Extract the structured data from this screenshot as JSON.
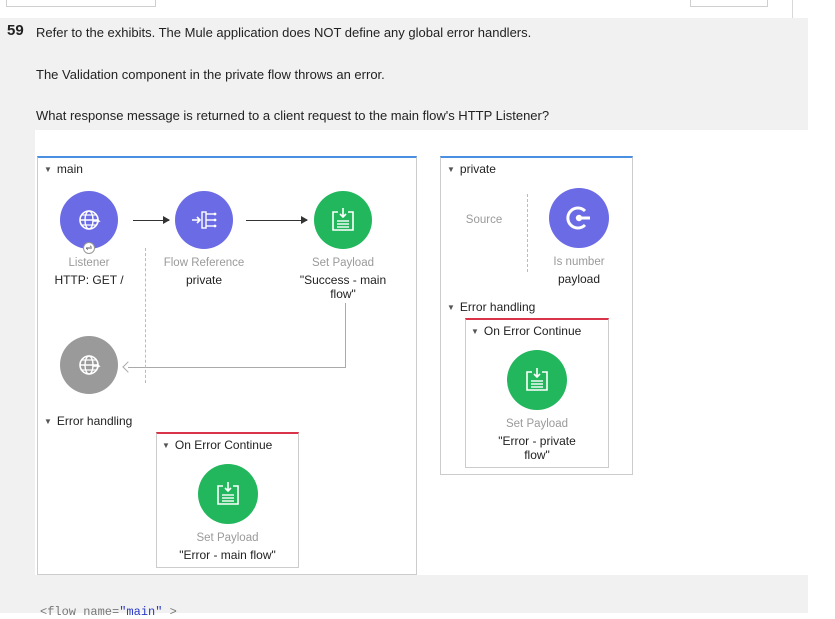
{
  "question": {
    "number": "59",
    "lines": [
      "Refer to the exhibits. The Mule application does NOT define any global error handlers.",
      "The Validation component in the private flow throws an error.",
      "What response message is returned to a client request to the main flow's HTTP Listener?"
    ]
  },
  "main_flow": {
    "title": "main",
    "listener": {
      "type": "Listener",
      "detail": "HTTP: GET /"
    },
    "flow_reference": {
      "type": "Flow Reference",
      "detail": "private"
    },
    "set_payload": {
      "type": "Set Payload",
      "detail": "\"Success - main flow\""
    },
    "error_handling_title": "Error handling",
    "on_error_continue": {
      "title": "On Error Continue",
      "set_payload": {
        "type": "Set Payload",
        "detail": "\"Error - main flow\""
      }
    }
  },
  "private_flow": {
    "title": "private",
    "source_label": "Source",
    "is_number": {
      "type": "Is number",
      "detail": "payload"
    },
    "error_handling_title": "Error handling",
    "on_error_continue": {
      "title": "On Error Continue",
      "set_payload": {
        "type": "Set Payload",
        "detail": "\"Error - private flow\""
      }
    }
  },
  "code_peek": {
    "prefix": "<flow name=",
    "value": "\"main\"",
    "suffix": " >"
  },
  "icons": [
    "globe-icon",
    "flow-reference-icon",
    "set-payload-icon",
    "validation-icon"
  ],
  "colors": {
    "panel_accent": "#4a90e2",
    "error_accent": "#d9344a",
    "purple": "#6b6be6",
    "green": "#23b75d"
  }
}
